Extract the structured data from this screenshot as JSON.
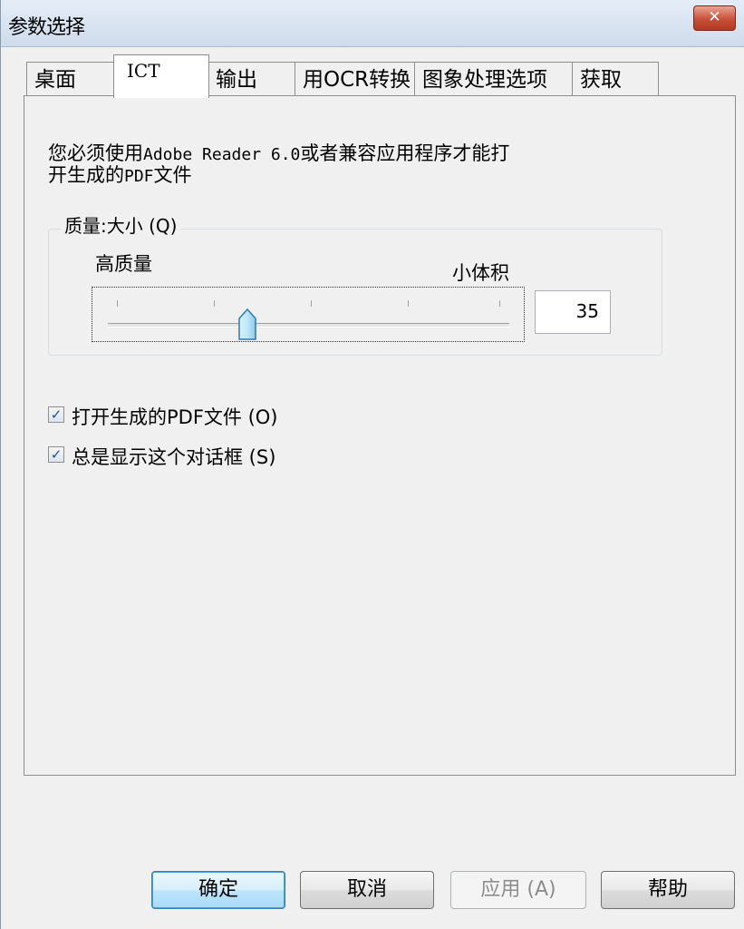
{
  "window": {
    "title": "参数选择",
    "close_symbol": "✕"
  },
  "tabs": [
    {
      "label": "桌面",
      "active": false
    },
    {
      "label": "ICT",
      "active": true
    },
    {
      "label": "输出",
      "active": false
    },
    {
      "label": "用OCR转换",
      "active": false
    },
    {
      "label": "图象处理选项",
      "active": false
    },
    {
      "label": "获取",
      "active": false
    }
  ],
  "info": {
    "prefix": "您必须使用",
    "app_name": "Adobe Reader 6.0",
    "suffix": "或者兼容应用程序才能打",
    "line2_a": "开生成的",
    "line2_pdf": "PDF",
    "line2_b": "文件"
  },
  "quality": {
    "group_label": "质量:大小 (Q)",
    "high_label": "高质量",
    "small_label": "小体积",
    "value": "35",
    "slider_fraction": 0.35
  },
  "checkboxes": [
    {
      "label": "打开生成的PDF文件 (O)",
      "checked": true,
      "check_mark": "✓"
    },
    {
      "label": "总是显示这个对话框 (S)",
      "checked": true,
      "check_mark": "✓"
    }
  ],
  "buttons": {
    "ok": "确定",
    "cancel": "取消",
    "apply": "应用 (A)",
    "help": "帮助"
  }
}
